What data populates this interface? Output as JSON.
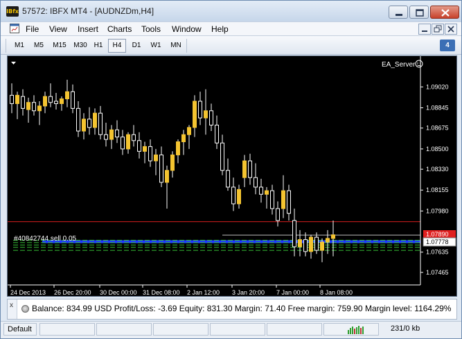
{
  "window": {
    "app_icon_text": "IBfx",
    "title": "57572: IBFX MT4 - [AUDNZDm,H4]"
  },
  "menu": {
    "items": [
      "File",
      "View",
      "Insert",
      "Charts",
      "Tools",
      "Window",
      "Help"
    ]
  },
  "toolbar": {
    "timeframes": [
      "M1",
      "M5",
      "M15",
      "M30",
      "H1",
      "H4",
      "D1",
      "W1",
      "MN"
    ],
    "active_timeframe": "H4",
    "notification_count": "4"
  },
  "chart": {
    "ea_label": "EA_Server",
    "order_label": "#40842744 sell 0.05",
    "red_line_price": "1.07890",
    "bid_price": "1.07778",
    "colors": {
      "background": "#000000",
      "bull_candle": "#f4c430",
      "bear_candle": "#ffffff",
      "wick": "#ffffff",
      "order_line": "#e02020",
      "blue_band": "#1f3bff",
      "green_levels": "#35c035",
      "grid_text": "#ffffff"
    }
  },
  "chart_data": {
    "type": "candlestick",
    "symbol": "AUDNZDm",
    "timeframe": "H4",
    "ylim": [
      1.0736,
      1.0915
    ],
    "y_ticks": [
      "1.09020",
      "1.08845",
      "1.08675",
      "1.08500",
      "1.08330",
      "1.08155",
      "1.07980",
      "1.07635",
      "1.07465"
    ],
    "x_ticks": [
      "24 Dec 2013",
      "26 Dec 20:00",
      "30 Dec 00:00",
      "31 Dec 08:00",
      "2 Jan 12:00",
      "3 Jan 20:00",
      "7 Jan 00:00",
      "8 Jan 08:00"
    ],
    "order_price": 1.0789,
    "bid": 1.07778,
    "green_level_prices": [
      1.07735,
      1.07715,
      1.07695,
      1.07675,
      1.0765
    ],
    "blue_band_range": [
      1.0771,
      1.07735
    ],
    "candles": [
      {
        "o": 1.0895,
        "h": 1.0905,
        "l": 1.088,
        "c": 1.0888
      },
      {
        "o": 1.0888,
        "h": 1.0898,
        "l": 1.0875,
        "c": 1.0895
      },
      {
        "o": 1.0894,
        "h": 1.09,
        "l": 1.0878,
        "c": 1.0884
      },
      {
        "o": 1.0883,
        "h": 1.0893,
        "l": 1.0872,
        "c": 1.0889
      },
      {
        "o": 1.0889,
        "h": 1.0895,
        "l": 1.0878,
        "c": 1.0882
      },
      {
        "o": 1.0882,
        "h": 1.089,
        "l": 1.087,
        "c": 1.0886
      },
      {
        "o": 1.0886,
        "h": 1.0898,
        "l": 1.088,
        "c": 1.0894
      },
      {
        "o": 1.0894,
        "h": 1.0905,
        "l": 1.0885,
        "c": 1.0889
      },
      {
        "o": 1.089,
        "h": 1.0897,
        "l": 1.0883,
        "c": 1.0888
      },
      {
        "o": 1.0888,
        "h": 1.0894,
        "l": 1.0882,
        "c": 1.0892
      },
      {
        "o": 1.0892,
        "h": 1.0908,
        "l": 1.0885,
        "c": 1.0898
      },
      {
        "o": 1.0898,
        "h": 1.0904,
        "l": 1.088,
        "c": 1.0884
      },
      {
        "o": 1.0884,
        "h": 1.089,
        "l": 1.086,
        "c": 1.0865
      },
      {
        "o": 1.0865,
        "h": 1.088,
        "l": 1.0858,
        "c": 1.0875
      },
      {
        "o": 1.0875,
        "h": 1.0885,
        "l": 1.0862,
        "c": 1.0868
      },
      {
        "o": 1.0868,
        "h": 1.0884,
        "l": 1.0862,
        "c": 1.088
      },
      {
        "o": 1.088,
        "h": 1.0886,
        "l": 1.0858,
        "c": 1.0862
      },
      {
        "o": 1.0862,
        "h": 1.0872,
        "l": 1.0852,
        "c": 1.0858
      },
      {
        "o": 1.0858,
        "h": 1.087,
        "l": 1.085,
        "c": 1.0866
      },
      {
        "o": 1.0866,
        "h": 1.0874,
        "l": 1.0855,
        "c": 1.086
      },
      {
        "o": 1.086,
        "h": 1.0866,
        "l": 1.0845,
        "c": 1.085
      },
      {
        "o": 1.085,
        "h": 1.0864,
        "l": 1.0846,
        "c": 1.0862
      },
      {
        "o": 1.0862,
        "h": 1.087,
        "l": 1.0852,
        "c": 1.0857
      },
      {
        "o": 1.0857,
        "h": 1.0864,
        "l": 1.0842,
        "c": 1.0848
      },
      {
        "o": 1.0848,
        "h": 1.0856,
        "l": 1.0838,
        "c": 1.0852
      },
      {
        "o": 1.0852,
        "h": 1.0858,
        "l": 1.0835,
        "c": 1.084
      },
      {
        "o": 1.084,
        "h": 1.085,
        "l": 1.0828,
        "c": 1.0845
      },
      {
        "o": 1.0845,
        "h": 1.0852,
        "l": 1.0818,
        "c": 1.0822
      },
      {
        "o": 1.0822,
        "h": 1.0836,
        "l": 1.08,
        "c": 1.0832
      },
      {
        "o": 1.0832,
        "h": 1.0848,
        "l": 1.0826,
        "c": 1.0845
      },
      {
        "o": 1.0845,
        "h": 1.0858,
        "l": 1.0838,
        "c": 1.0856
      },
      {
        "o": 1.0856,
        "h": 1.0866,
        "l": 1.0845,
        "c": 1.0862
      },
      {
        "o": 1.0862,
        "h": 1.087,
        "l": 1.085,
        "c": 1.0868
      },
      {
        "o": 1.0868,
        "h": 1.0895,
        "l": 1.086,
        "c": 1.089
      },
      {
        "o": 1.089,
        "h": 1.0898,
        "l": 1.087,
        "c": 1.0876
      },
      {
        "o": 1.0876,
        "h": 1.09,
        "l": 1.0862,
        "c": 1.0882
      },
      {
        "o": 1.0882,
        "h": 1.0888,
        "l": 1.0865,
        "c": 1.087
      },
      {
        "o": 1.087,
        "h": 1.0878,
        "l": 1.085,
        "c": 1.0855
      },
      {
        "o": 1.0855,
        "h": 1.0862,
        "l": 1.0828,
        "c": 1.0832
      },
      {
        "o": 1.0832,
        "h": 1.0842,
        "l": 1.0815,
        "c": 1.0818
      },
      {
        "o": 1.0818,
        "h": 1.0826,
        "l": 1.0798,
        "c": 1.0804
      },
      {
        "o": 1.0804,
        "h": 1.082,
        "l": 1.08,
        "c": 1.0816
      },
      {
        "o": 1.0826,
        "h": 1.0845,
        "l": 1.0818,
        "c": 1.084
      },
      {
        "o": 1.084,
        "h": 1.0846,
        "l": 1.082,
        "c": 1.0826
      },
      {
        "o": 1.0826,
        "h": 1.0838,
        "l": 1.0812,
        "c": 1.0818
      },
      {
        "o": 1.0818,
        "h": 1.0825,
        "l": 1.0805,
        "c": 1.0812
      },
      {
        "o": 1.0812,
        "h": 1.0818,
        "l": 1.08,
        "c": 1.0815
      },
      {
        "o": 1.0815,
        "h": 1.082,
        "l": 1.0795,
        "c": 1.08
      },
      {
        "o": 1.08,
        "h": 1.0806,
        "l": 1.0785,
        "c": 1.079
      },
      {
        "o": 1.08,
        "h": 1.0828,
        "l": 1.0792,
        "c": 1.0815
      },
      {
        "o": 1.0815,
        "h": 1.082,
        "l": 1.079,
        "c": 1.0796
      },
      {
        "o": 1.079,
        "h": 1.08,
        "l": 1.076,
        "c": 1.0768
      },
      {
        "o": 1.0768,
        "h": 1.0782,
        "l": 1.076,
        "c": 1.0774
      },
      {
        "o": 1.0774,
        "h": 1.078,
        "l": 1.076,
        "c": 1.0764
      },
      {
        "o": 1.0764,
        "h": 1.0778,
        "l": 1.0758,
        "c": 1.0776
      },
      {
        "o": 1.0776,
        "h": 1.078,
        "l": 1.0762,
        "c": 1.0765
      },
      {
        "o": 1.0765,
        "h": 1.0775,
        "l": 1.0755,
        "c": 1.0772
      },
      {
        "o": 1.0772,
        "h": 1.0782,
        "l": 1.0762,
        "c": 1.0775
      },
      {
        "o": 1.0775,
        "h": 1.079,
        "l": 1.076,
        "c": 1.0778
      }
    ]
  },
  "terminal": {
    "side_label": "x",
    "summary": "Balance: 834.99 USD  Profit/Loss: -3.69  Equity: 831.30  Margin: 71.40  Free margin: 759.90  Margin level: 1164.29%"
  },
  "status": {
    "profile": "Default",
    "traffic": "231/0 kb"
  }
}
